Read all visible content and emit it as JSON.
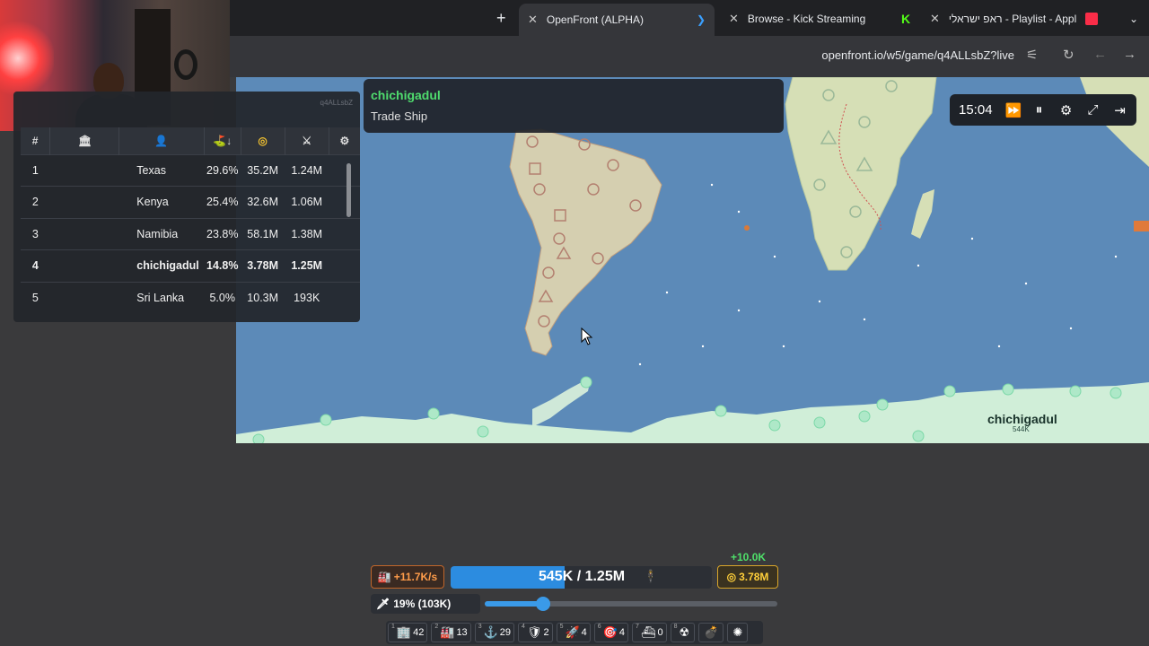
{
  "browser": {
    "tabs": [
      {
        "label": "OpenFront (ALPHA)",
        "active": true
      },
      {
        "label": "Browse - Kick Streaming",
        "active": false
      },
      {
        "label": "ראפ ישראלי - Playlist - Appl",
        "active": false
      }
    ],
    "new_tab": "+",
    "url": "openfront.io/w5/game/q4ALLsbZ?live"
  },
  "tooltip": {
    "player": "chichigadul",
    "unit": "Trade Ship"
  },
  "leaderboard": {
    "game_id": "q4ALLsbZ",
    "headers": {
      "rank": "#"
    },
    "rows": [
      {
        "rank": "1",
        "name": "Texas",
        "territory": "29.6%",
        "gold": "35.2M",
        "troops": "1.24M",
        "me": false
      },
      {
        "rank": "2",
        "name": "Kenya",
        "territory": "25.4%",
        "gold": "32.6M",
        "troops": "1.06M",
        "me": false
      },
      {
        "rank": "3",
        "name": "Namibia",
        "territory": "23.8%",
        "gold": "58.1M",
        "troops": "1.38M",
        "me": false
      },
      {
        "rank": "4",
        "name": "chichigadul",
        "territory": "14.8%",
        "gold": "3.78M",
        "troops": "1.25M",
        "me": true
      },
      {
        "rank": "5",
        "name": "Sri Lanka",
        "territory": "5.0%",
        "gold": "10.3M",
        "troops": "193K",
        "me": false
      }
    ]
  },
  "controls": {
    "time": "15:04"
  },
  "map_label": {
    "name": "chichigadul",
    "troops": "544K"
  },
  "hud": {
    "gold_delta": "+10.0K",
    "gold_rate": "+11.7K/s",
    "troops": "545K / 1.25M",
    "troops_fraction": 0.436,
    "gold": "3.78M",
    "attack_ratio": "19% (103K)",
    "attack_fraction": 0.19,
    "build": [
      {
        "key": "1",
        "icon": "city-icon",
        "count": "42"
      },
      {
        "key": "2",
        "icon": "factory-icon",
        "count": "13"
      },
      {
        "key": "3",
        "icon": "port-icon",
        "count": "29"
      },
      {
        "key": "4",
        "icon": "defense-post-icon",
        "count": "2"
      },
      {
        "key": "5",
        "icon": "missile-silo-icon",
        "count": "4"
      },
      {
        "key": "6",
        "icon": "sam-launcher-icon",
        "count": "4"
      },
      {
        "key": "7",
        "icon": "warship-icon",
        "count": "0"
      },
      {
        "key": "8",
        "icon": "nuke-icon",
        "count": ""
      },
      {
        "key": "",
        "icon": "hydrogen-bomb-icon",
        "count": ""
      },
      {
        "key": "",
        "icon": "mirv-icon",
        "count": ""
      }
    ]
  }
}
